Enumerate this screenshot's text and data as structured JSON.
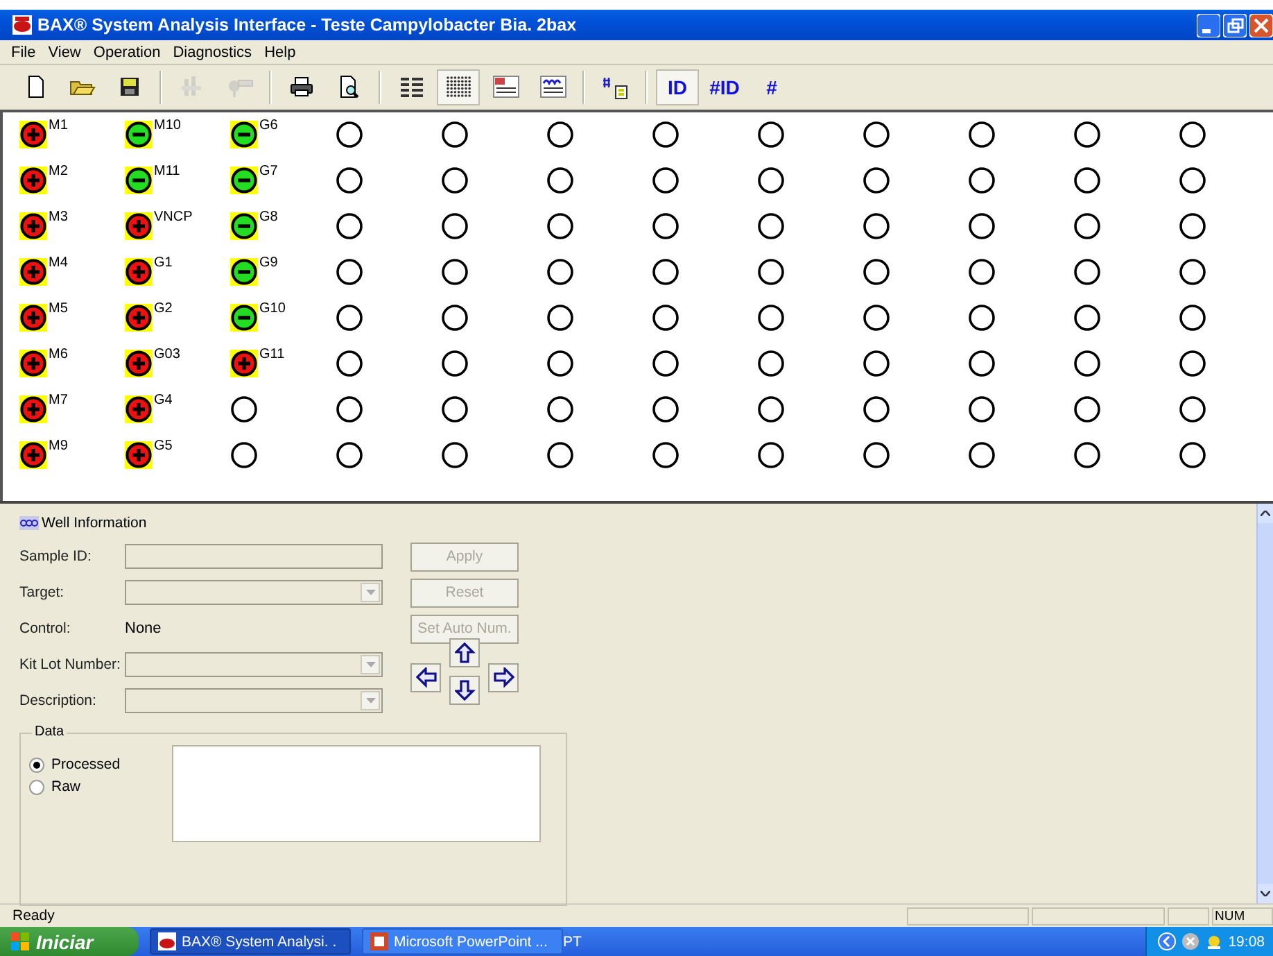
{
  "window": {
    "title": "BAX® System Analysis Interface - Teste Campylobacter Bia. 2bax"
  },
  "menu": [
    "File",
    "View",
    "Operation",
    "Diagnostics",
    "Help"
  ],
  "toolbar": [
    {
      "kind": "icon",
      "disabled": false,
      "pressed": false
    },
    {
      "kind": "icon",
      "disabled": false,
      "pressed": false
    },
    {
      "kind": "icon",
      "disabled": false,
      "pressed": false
    },
    {
      "kind": "icon",
      "disabled": true,
      "pressed": false
    },
    {
      "kind": "icon",
      "disabled": true,
      "pressed": false
    },
    {
      "kind": "icon",
      "disabled": false,
      "pressed": false
    },
    {
      "kind": "icon",
      "disabled": false,
      "pressed": false
    },
    {
      "kind": "icon",
      "disabled": false,
      "pressed": false
    },
    {
      "kind": "icon",
      "disabled": false,
      "pressed": true
    },
    {
      "kind": "icon",
      "disabled": false,
      "pressed": false
    },
    {
      "kind": "icon",
      "disabled": false,
      "pressed": false
    },
    {
      "kind": "icon",
      "disabled": false,
      "pressed": false
    },
    {
      "kind": "text",
      "label": "ID",
      "pressed": true
    },
    {
      "kind": "text",
      "label": "#ID",
      "pressed": false
    },
    {
      "kind": "text",
      "label": "#",
      "pressed": false
    }
  ],
  "well_grid": {
    "rows": [
      [
        {
          "kind": "positive",
          "label": "M1"
        },
        {
          "kind": "negative",
          "label": "M10"
        },
        {
          "kind": "negative",
          "label": "G6"
        },
        {
          "kind": "empty"
        },
        {
          "kind": "empty"
        },
        {
          "kind": "empty"
        },
        {
          "kind": "empty"
        },
        {
          "kind": "empty"
        },
        {
          "kind": "empty"
        },
        {
          "kind": "empty"
        },
        {
          "kind": "empty"
        },
        {
          "kind": "empty"
        }
      ],
      [
        {
          "kind": "positive",
          "label": "M2"
        },
        {
          "kind": "negative",
          "label": "M11"
        },
        {
          "kind": "negative",
          "label": "G7"
        },
        {
          "kind": "empty"
        },
        {
          "kind": "empty"
        },
        {
          "kind": "empty"
        },
        {
          "kind": "empty"
        },
        {
          "kind": "empty"
        },
        {
          "kind": "empty"
        },
        {
          "kind": "empty"
        },
        {
          "kind": "empty"
        },
        {
          "kind": "empty"
        }
      ],
      [
        {
          "kind": "positive",
          "label": "M3"
        },
        {
          "kind": "positive",
          "label": "VNCP"
        },
        {
          "kind": "negative",
          "label": "G8"
        },
        {
          "kind": "empty"
        },
        {
          "kind": "empty"
        },
        {
          "kind": "empty"
        },
        {
          "kind": "empty"
        },
        {
          "kind": "empty"
        },
        {
          "kind": "empty"
        },
        {
          "kind": "empty"
        },
        {
          "kind": "empty"
        },
        {
          "kind": "empty"
        }
      ],
      [
        {
          "kind": "positive",
          "label": "M4"
        },
        {
          "kind": "positive",
          "label": "G1"
        },
        {
          "kind": "negative",
          "label": "G9"
        },
        {
          "kind": "empty"
        },
        {
          "kind": "empty"
        },
        {
          "kind": "empty"
        },
        {
          "kind": "empty"
        },
        {
          "kind": "empty"
        },
        {
          "kind": "empty"
        },
        {
          "kind": "empty"
        },
        {
          "kind": "empty"
        },
        {
          "kind": "empty"
        }
      ],
      [
        {
          "kind": "positive",
          "label": "M5"
        },
        {
          "kind": "positive",
          "label": "G2"
        },
        {
          "kind": "negative",
          "label": "G10"
        },
        {
          "kind": "empty"
        },
        {
          "kind": "empty"
        },
        {
          "kind": "empty"
        },
        {
          "kind": "empty"
        },
        {
          "kind": "empty"
        },
        {
          "kind": "empty"
        },
        {
          "kind": "empty"
        },
        {
          "kind": "empty"
        },
        {
          "kind": "empty"
        }
      ],
      [
        {
          "kind": "positive",
          "label": "M6"
        },
        {
          "kind": "positive",
          "label": "G03"
        },
        {
          "kind": "positive",
          "label": "G11"
        },
        {
          "kind": "empty"
        },
        {
          "kind": "empty"
        },
        {
          "kind": "empty"
        },
        {
          "kind": "empty"
        },
        {
          "kind": "empty"
        },
        {
          "kind": "empty"
        },
        {
          "kind": "empty"
        },
        {
          "kind": "empty"
        },
        {
          "kind": "empty"
        }
      ],
      [
        {
          "kind": "positive",
          "label": "M7"
        },
        {
          "kind": "positive",
          "label": "G4"
        },
        {
          "kind": "empty"
        },
        {
          "kind": "empty"
        },
        {
          "kind": "empty"
        },
        {
          "kind": "empty"
        },
        {
          "kind": "empty"
        },
        {
          "kind": "empty"
        },
        {
          "kind": "empty"
        },
        {
          "kind": "empty"
        },
        {
          "kind": "empty"
        },
        {
          "kind": "empty"
        }
      ],
      [
        {
          "kind": "positive",
          "label": "M9"
        },
        {
          "kind": "positive",
          "label": "G5"
        },
        {
          "kind": "empty"
        },
        {
          "kind": "empty"
        },
        {
          "kind": "empty"
        },
        {
          "kind": "empty"
        },
        {
          "kind": "empty"
        },
        {
          "kind": "empty"
        },
        {
          "kind": "empty"
        },
        {
          "kind": "empty"
        },
        {
          "kind": "empty"
        },
        {
          "kind": "empty"
        }
      ]
    ]
  },
  "well_information": {
    "title": "Well Information",
    "fields": [
      {
        "label": "Sample ID:",
        "kind": "text",
        "disabled": true
      },
      {
        "label": "Target:",
        "kind": "combo",
        "disabled": true
      },
      {
        "label": "Control:",
        "kind": "static",
        "value": "None"
      },
      {
        "label": "Kit Lot Number:",
        "kind": "combo",
        "disabled": true
      },
      {
        "label": "Description:",
        "kind": "combo",
        "disabled": true
      }
    ],
    "buttons": [
      {
        "label": "Apply",
        "disabled": true
      },
      {
        "label": "Reset",
        "disabled": true
      },
      {
        "label": "Set Auto Num.",
        "disabled": true
      }
    ],
    "data_group": {
      "title": "Data",
      "options": [
        {
          "label": "Processed",
          "selected": true
        },
        {
          "label": "Raw",
          "selected": false
        }
      ]
    }
  },
  "status_bar": {
    "text": "Ready",
    "indicators": [
      "NUM"
    ]
  },
  "taskbar": {
    "start": "Iniciar",
    "tasks": [
      {
        "label": "BAX® System Analysi. .",
        "selected": true
      },
      {
        "label": "Microsoft PowerPoint ...",
        "selected": false
      }
    ],
    "language": "PT",
    "clock": "19:08"
  }
}
